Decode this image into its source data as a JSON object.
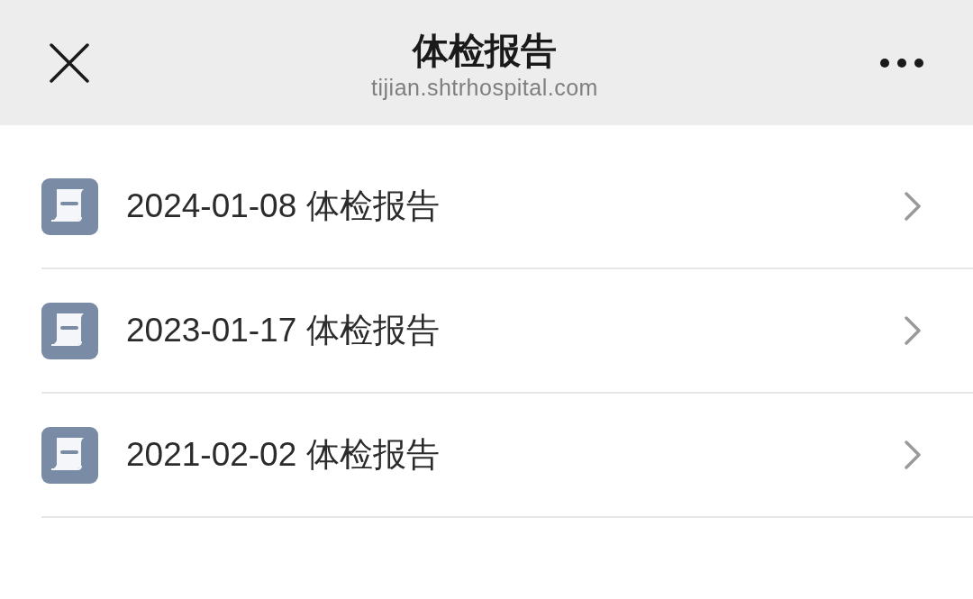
{
  "header": {
    "title": "体检报告",
    "url": "tijian.shtrhospital.com"
  },
  "reports": [
    {
      "label": "2024-01-08 体检报告"
    },
    {
      "label": "2023-01-17 体检报告"
    },
    {
      "label": "2021-02-02 体检报告"
    }
  ]
}
